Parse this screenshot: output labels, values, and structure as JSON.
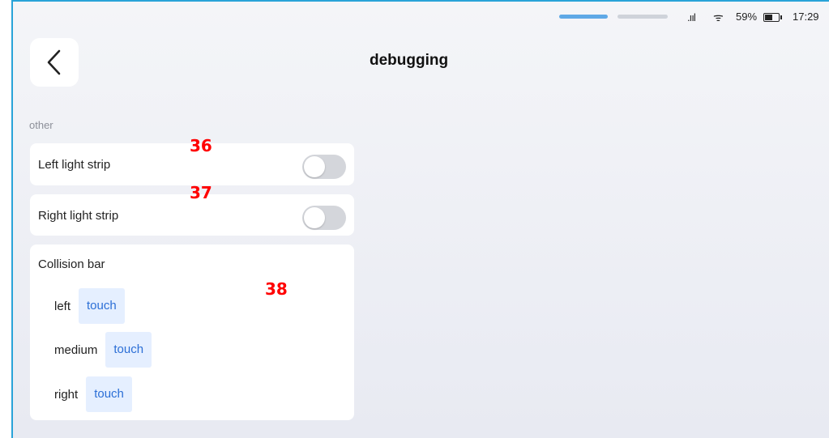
{
  "status": {
    "signal": ".ııl",
    "wifi": "ᯤ",
    "battery": "59%",
    "time": "17:29"
  },
  "header": {
    "title": "debugging"
  },
  "section": {
    "label": "other"
  },
  "rows": [
    {
      "label": "Left light strip",
      "toggle": "off"
    },
    {
      "label": "Right light strip",
      "toggle": "off"
    }
  ],
  "collision": {
    "title": "Collision bar",
    "items": [
      {
        "label": "left",
        "button": "touch"
      },
      {
        "label": "medium",
        "button": "touch"
      },
      {
        "label": "right",
        "button": "touch"
      }
    ]
  },
  "annotations": [
    "36",
    "37",
    "38"
  ],
  "colors": {
    "accent": "#2c6fd6",
    "touch_bg": "#e5efff",
    "annotation": "#ff0000",
    "toggle_off": "#d4d6db"
  }
}
